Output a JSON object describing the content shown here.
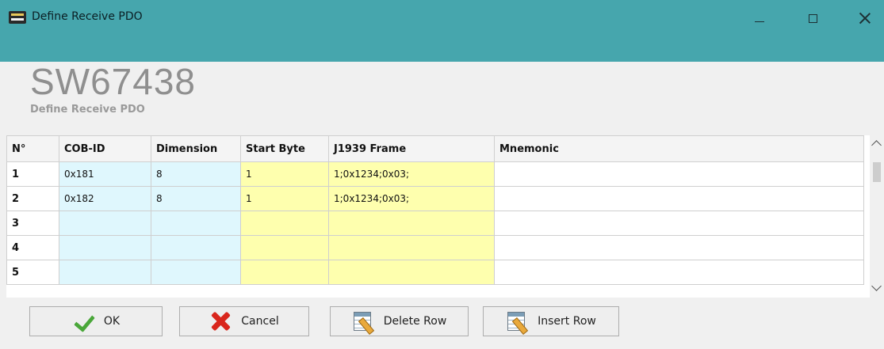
{
  "window": {
    "title": "Define Receive PDO",
    "controls": {
      "minimize": "minimize-icon",
      "maximize": "maximize-icon",
      "close": "close-icon"
    }
  },
  "header": {
    "product": "SW67438",
    "subtitle": "Define Receive PDO"
  },
  "grid": {
    "columns": [
      "N°",
      "COB-ID",
      "Dimension",
      "Start Byte",
      "J1939 Frame",
      "Mnemonic"
    ],
    "rows": [
      {
        "n": "1",
        "cob_id": "0x181",
        "dimension": "8",
        "start_byte": "1",
        "j1939_frame": "1;0x1234;0x03;",
        "mnemonic": ""
      },
      {
        "n": "2",
        "cob_id": "0x182",
        "dimension": "8",
        "start_byte": "1",
        "j1939_frame": "1;0x1234;0x03;",
        "mnemonic": ""
      },
      {
        "n": "3",
        "cob_id": "",
        "dimension": "",
        "start_byte": "",
        "j1939_frame": "",
        "mnemonic": ""
      },
      {
        "n": "4",
        "cob_id": "",
        "dimension": "",
        "start_byte": "",
        "j1939_frame": "",
        "mnemonic": ""
      },
      {
        "n": "5",
        "cob_id": "",
        "dimension": "",
        "start_byte": "",
        "j1939_frame": "",
        "mnemonic": ""
      }
    ]
  },
  "buttons": {
    "ok": "OK",
    "cancel": "Cancel",
    "delete_row": "Delete Row",
    "insert_row": "Insert Row"
  },
  "colors": {
    "titlebar": "#46a6ad",
    "cob_dim_cells": "#dff7fd",
    "start_frame_cells": "#feffae"
  }
}
